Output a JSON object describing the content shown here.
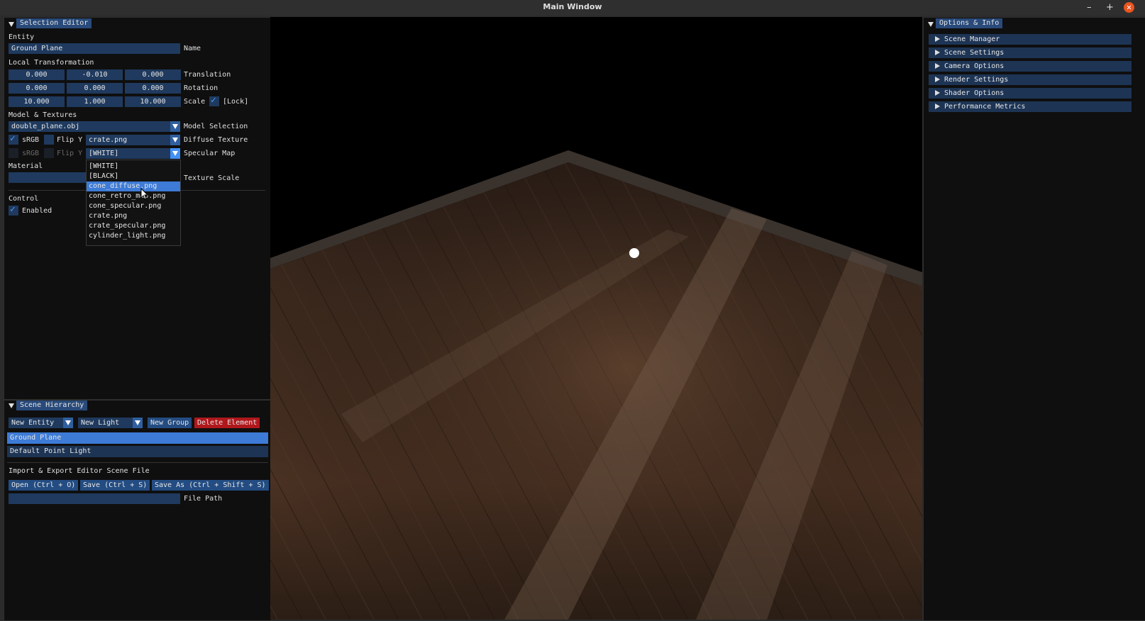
{
  "window": {
    "title": "Main Window",
    "minimize": "–",
    "maximize": "+",
    "close": "✕"
  },
  "selection_editor": {
    "title": "Selection Editor",
    "entity_header": "Entity",
    "name_value": "Ground Plane",
    "name_label": "Name",
    "local_transform_header": "Local Transformation",
    "translation": [
      "0.000",
      "-0.010",
      "0.000"
    ],
    "translation_label": "Translation",
    "rotation": [
      "0.000",
      "0.000",
      "0.000"
    ],
    "rotation_label": "Rotation",
    "scale": [
      "10.000",
      "1.000",
      "10.000"
    ],
    "scale_label": "Scale",
    "lock_label": "[Lock]",
    "lock_checked": true,
    "model_textures_header": "Model & Textures",
    "model_value": "double_plane.obj",
    "model_label": "Model Selection",
    "srgb_label": "sRGB",
    "flipy_label": "Flip Y",
    "diffuse_value": "crate.png",
    "diffuse_label": "Diffuse Texture",
    "specular_value": "[WHITE]",
    "specular_label": "Specular Map",
    "material_header": "Material",
    "texture_scale_label": "Texture Scale",
    "control_header": "Control",
    "enabled_label": "Enabled",
    "dropdown_items": [
      "[WHITE]",
      "[BLACK]",
      "cone_diffuse.png",
      "cone_retro_map.png",
      "cone_specular.png",
      "crate.png",
      "crate_specular.png",
      "cylinder_light.png"
    ],
    "dropdown_highlighted": "cone_diffuse.png"
  },
  "scene_hierarchy": {
    "title": "Scene Hierarchy",
    "new_entity": "New Entity",
    "new_light": "New Light",
    "new_group": "New Group",
    "delete_element": "Delete Element",
    "items": [
      "Ground Plane",
      "Default Point Light"
    ],
    "import_export_header": "Import & Export Editor Scene File",
    "open_btn": "Open (Ctrl + O)",
    "save_btn": "Save (Ctrl + S)",
    "save_as_btn": "Save As (Ctrl + Shift + S)",
    "file_path_label": "File Path"
  },
  "options_info": {
    "title": "Options & Info",
    "items": [
      "Scene Manager",
      "Scene Settings",
      "Camera Options",
      "Render Settings",
      "Shader Options",
      "Performance Metrics"
    ]
  },
  "colors": {
    "accent": "#3d7bd6",
    "title_bg": "#294a7a",
    "field_bg": "#1f3a5e",
    "danger": "#b0181c"
  }
}
